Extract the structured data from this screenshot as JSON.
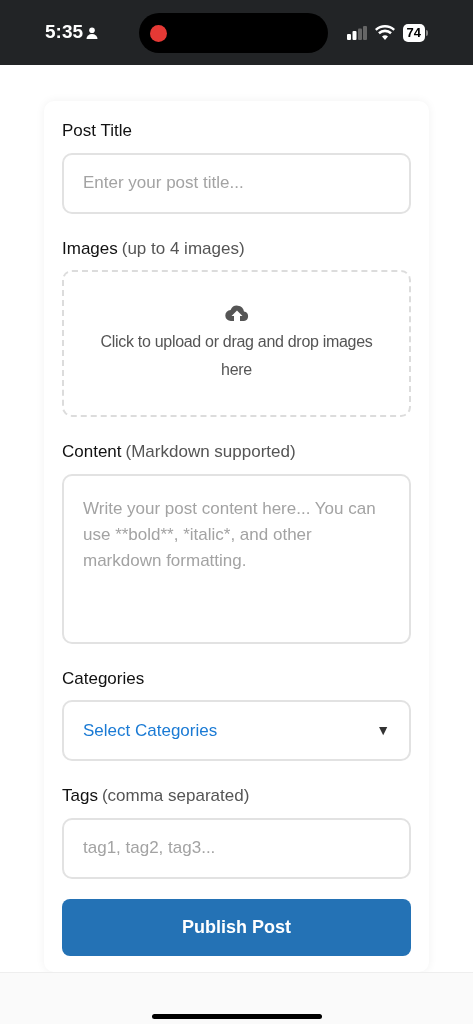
{
  "status_bar": {
    "time": "5:35",
    "battery": "74",
    "recording": true
  },
  "form": {
    "fields": [
      {
        "kind": "text",
        "label": "Post Title",
        "placeholder": "Enter your post title..."
      },
      {
        "kind": "upload",
        "label": "Images",
        "hint": "(up to 4 images)",
        "prompt": "Click to upload or drag and drop images here"
      },
      {
        "kind": "textarea",
        "label": "Content",
        "hint": "(Markdown supported)",
        "placeholder": "Write your post content here... You can use **bold**, *italic*, and other markdown formatting."
      },
      {
        "kind": "select",
        "label": "Categories",
        "value": "Select Categories",
        "caret": "▼"
      },
      {
        "kind": "text",
        "label": "Tags",
        "hint": "(comma separated)",
        "placeholder": "tag1, tag2, tag3..."
      }
    ],
    "submit": "Publish Post"
  }
}
